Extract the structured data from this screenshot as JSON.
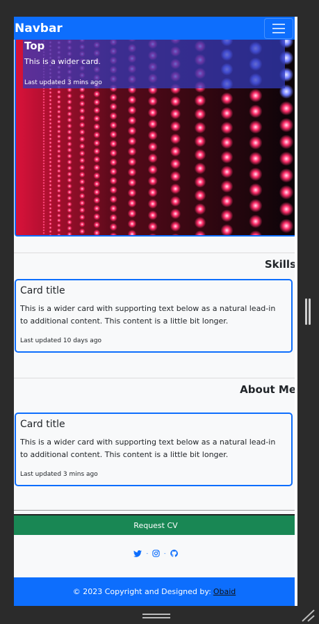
{
  "navbar": {
    "brand": "Navbar"
  },
  "hero": {
    "title": "Top",
    "text": "This is a wider card.",
    "updated": "Last updated 3 mins ago"
  },
  "sections": {
    "skills": "Skills",
    "about": "About Me"
  },
  "cards": [
    {
      "title": "Card title",
      "text": "This is a wider card with supporting text below as a natural lead-in to additional content. This content is a little bit longer.",
      "updated": "Last updated 10 days ago"
    },
    {
      "title": "Card title",
      "text": "This is a wider card with supporting text below as a natural lead-in to additional content. This content is a little bit longer.",
      "updated": "Last updated 3 mins ago"
    }
  ],
  "cv_button": "Request CV",
  "social": {
    "icons": [
      "twitter-icon",
      "instagram-icon",
      "github-icon"
    ],
    "separator": "-"
  },
  "footer": {
    "text": "© 2023 Copyright and Designed by:",
    "author": "Obaid"
  },
  "colors": {
    "primary": "#0d6efd",
    "success": "#198754",
    "background": "#f8f9fa",
    "window": "#2b2b2b"
  }
}
